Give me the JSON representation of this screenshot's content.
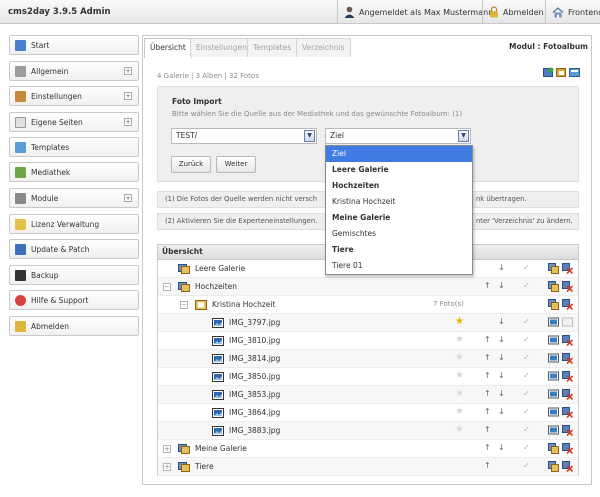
{
  "app": {
    "title": "cms2day 3.9.5 Admin",
    "user": "Angemeldet als Max Mustermann",
    "logout": "Abmelden",
    "frontend": "Frontend"
  },
  "sidebar": {
    "items": [
      {
        "label": "Start"
      },
      {
        "label": "Allgemein"
      },
      {
        "label": "Einstellungen"
      },
      {
        "label": "Eigene Seiten"
      },
      {
        "label": "Templates"
      },
      {
        "label": "Mediathek"
      },
      {
        "label": "Module"
      },
      {
        "label": "Lizenz Verwaltung"
      },
      {
        "label": "Update & Patch"
      },
      {
        "label": "Backup"
      },
      {
        "label": "Hilfe & Support"
      },
      {
        "label": "Abmelden"
      }
    ]
  },
  "tabs": [
    "Übersicht",
    "Einstellungen",
    "Templates",
    "Verzeichnis"
  ],
  "module_title": "Modul : Fotoalbum",
  "stats": "4 Galerie | 3 Alben | 32 Fotos",
  "import": {
    "title": "Foto Import",
    "description": "Bitte wählen Sie die Quelle aus der Mediathek und das gewünschte Fotoalbum: (1)",
    "source_value": "TEST/",
    "target_value": "Ziel",
    "back_label": "Zurück",
    "next_label": "Weiter"
  },
  "info": {
    "line1_left": "(1) Die Fotos der Quelle werden nicht versch",
    "line1_right": "nk übertragen.",
    "line2_left": "(2) Aktivieren Sie die Experteneinstellungen.",
    "line2_right": "nter 'Verzeichnis' zu ändern."
  },
  "dropdown": {
    "options": [
      {
        "label": "Ziel",
        "style": "selected"
      },
      {
        "label": "Leere Galerie",
        "style": "bold"
      },
      {
        "label": "Hochzeiten",
        "style": "bold"
      },
      {
        "label": "Kristina Hochzeit",
        "style": "normal"
      },
      {
        "label": "Meine Galerie",
        "style": "bold"
      },
      {
        "label": "Gemischtes",
        "style": "normal"
      },
      {
        "label": "Tiere",
        "style": "bold"
      },
      {
        "label": "Tiere 01",
        "style": "normal"
      }
    ]
  },
  "tree": {
    "header": "Übersicht",
    "rows": [
      {
        "label": "Leere Galerie",
        "type": "gallery",
        "level": 0,
        "expander": "",
        "count": "",
        "star": "",
        "up": false,
        "down": true
      },
      {
        "label": "Hochzeiten",
        "type": "gallery",
        "level": 0,
        "expander": "−",
        "count": "",
        "star": "",
        "up": true,
        "down": true
      },
      {
        "label": "Kristina Hochzeit",
        "type": "album",
        "level": 1,
        "expander": "−",
        "count": "7 Foto(s)",
        "star": "",
        "up": false,
        "down": false
      },
      {
        "label": "IMG_3797.jpg",
        "type": "photo",
        "level": 2,
        "expander": "",
        "count": "",
        "star": "on",
        "up": false,
        "down": true
      },
      {
        "label": "IMG_3810.jpg",
        "type": "photo",
        "level": 2,
        "expander": "",
        "count": "",
        "star": "off",
        "up": true,
        "down": true
      },
      {
        "label": "IMG_3814.jpg",
        "type": "photo",
        "level": 2,
        "expander": "",
        "count": "",
        "star": "off",
        "up": true,
        "down": true
      },
      {
        "label": "IMG_3850.jpg",
        "type": "photo",
        "level": 2,
        "expander": "",
        "count": "",
        "star": "off",
        "up": true,
        "down": true
      },
      {
        "label": "IMG_3853.jpg",
        "type": "photo",
        "level": 2,
        "expander": "",
        "count": "",
        "star": "off",
        "up": true,
        "down": true
      },
      {
        "label": "IMG_3864.jpg",
        "type": "photo",
        "level": 2,
        "expander": "",
        "count": "",
        "star": "off",
        "up": true,
        "down": true
      },
      {
        "label": "IMG_3883.jpg",
        "type": "photo",
        "level": 2,
        "expander": "",
        "count": "",
        "star": "off",
        "up": true,
        "down": false
      },
      {
        "label": "Meine Galerie",
        "type": "gallery",
        "level": 0,
        "expander": "+",
        "count": "",
        "star": "",
        "up": true,
        "down": true
      },
      {
        "label": "Tiere",
        "type": "gallery",
        "level": 0,
        "expander": "+",
        "count": "",
        "star": "",
        "up": true,
        "down": false
      }
    ]
  },
  "colors": {
    "accent": "#3f7be0",
    "star_on": "#e8b300"
  }
}
